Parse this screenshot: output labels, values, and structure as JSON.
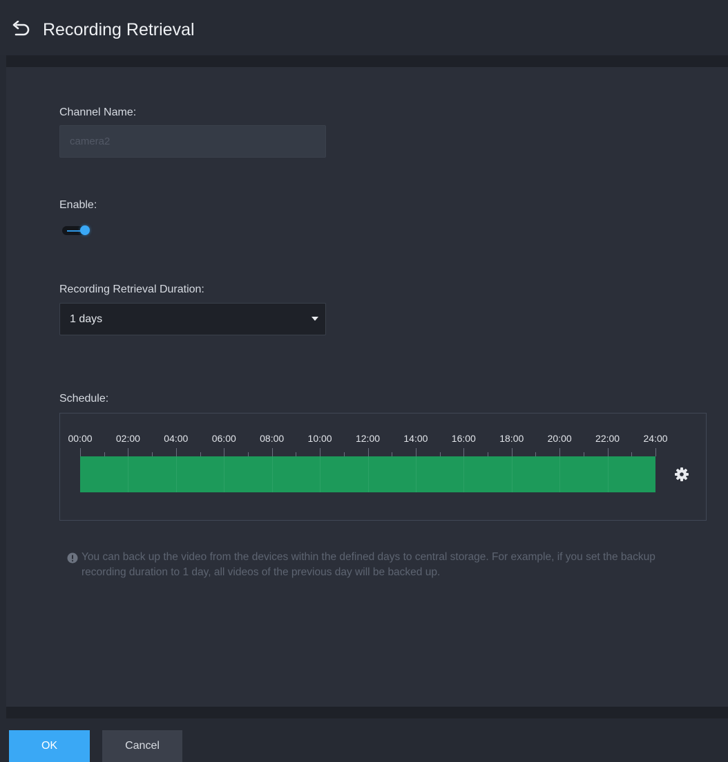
{
  "header": {
    "back_icon": "undo-arrow-icon",
    "title": "Recording Retrieval"
  },
  "form": {
    "channel_name_label": "Channel Name:",
    "channel_name_value": "camera2",
    "enable_label": "Enable:",
    "enable_value": true,
    "duration_label": "Recording Retrieval Duration:",
    "duration_value": "1 days",
    "schedule_label": "Schedule:"
  },
  "schedule": {
    "ticks": [
      "00:00",
      "02:00",
      "04:00",
      "06:00",
      "08:00",
      "10:00",
      "12:00",
      "14:00",
      "16:00",
      "18:00",
      "20:00",
      "22:00",
      "24:00"
    ],
    "active_start": "00:00",
    "active_end": "24:00",
    "bar_color": "#1d9a5a",
    "settings_icon": "gear-icon"
  },
  "info": {
    "icon": "info-icon",
    "text": "You can back up the video from the devices within the defined days to central storage. For example, if you set the backup recording duration to 1 day, all videos of the previous day will be backed up."
  },
  "footer": {
    "ok_label": "OK",
    "cancel_label": "Cancel"
  },
  "colors": {
    "accent": "#3aa8f5",
    "background": "#262a33",
    "panel": "#2b2f39"
  }
}
